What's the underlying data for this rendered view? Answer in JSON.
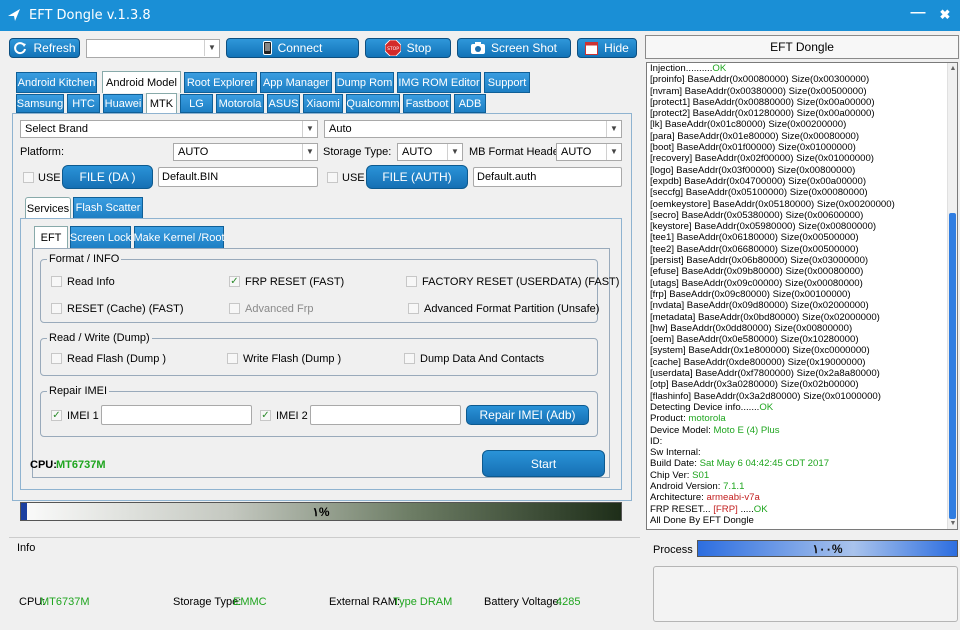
{
  "window": {
    "title": "EFT Dongle  v.1.3.8",
    "minimize": "—",
    "close": "✖"
  },
  "toolbar": {
    "refresh": "Refresh",
    "connect": "Connect",
    "stop": "Stop",
    "screenshot": "Screen Shot",
    "hide": "Hide",
    "stop_icon_text": "STOP",
    "port_value": ""
  },
  "main_tabs": [
    "Android Kitchen",
    "Android Model",
    "Root Explorer",
    "App Manager",
    "Dump Rom",
    "IMG ROM Editor",
    "Support"
  ],
  "brand_tabs": [
    "Samsung",
    "HTC",
    "Huawei",
    "MTK",
    "LG",
    "Motorola",
    "ASUS",
    "Xiaomi",
    "Qualcomm",
    "Fastboot",
    "ADB"
  ],
  "brand_select": {
    "value": "Select Brand"
  },
  "model_select": {
    "value": "Auto"
  },
  "platform": {
    "label": "Platform:",
    "value": "AUTO"
  },
  "storage": {
    "label": "Storage Type:",
    "value": "AUTO"
  },
  "mb_format": {
    "label": "MB Format Header",
    "value": "AUTO"
  },
  "da": {
    "use": "USE",
    "button": "FILE (DA )",
    "value": "Default.BIN"
  },
  "auth": {
    "use": "USE",
    "button": "FILE (AUTH)",
    "value": "Default.auth"
  },
  "sub_tabs": [
    "Services",
    "Flash Scatter"
  ],
  "service_tabs": [
    "EFT",
    "Screen Lock",
    "Make Kernel  /Root"
  ],
  "format_group": {
    "title": "Format / INFO",
    "items": [
      {
        "label": "Read Info",
        "checked": false
      },
      {
        "label": "FRP RESET (FAST)",
        "checked": true
      },
      {
        "label": "FACTORY RESET (USERDATA) (FAST)",
        "checked": false
      },
      {
        "label": "RESET (Cache) (FAST)",
        "checked": false
      },
      {
        "label": "Advanced Frp",
        "checked": false
      },
      {
        "label": "Advanced Format Partition (Unsafe)",
        "checked": false
      }
    ]
  },
  "rw_group": {
    "title": "Read / Write (Dump)",
    "items": [
      {
        "label": "Read Flash (Dump )",
        "checked": false
      },
      {
        "label": "Write Flash (Dump )",
        "checked": false
      },
      {
        "label": "Dump Data And Contacts",
        "checked": false
      }
    ]
  },
  "imei_group": {
    "title": "Repair IMEI",
    "imei1": {
      "label": "IMEI 1",
      "checked": true,
      "value": ""
    },
    "imei2": {
      "label": "IMEI 2",
      "checked": true,
      "value": ""
    },
    "repair_button": "Repair IMEI (Adb)"
  },
  "cpu": {
    "label": "CPU:",
    "value": "MT6737M"
  },
  "start_button": "Start",
  "progress_main": {
    "text": "١%",
    "value": 0.01
  },
  "info": {
    "title": "Info",
    "cpu_label": "CPU:",
    "cpu_value": "MT6737M",
    "storage_label": "Storage Type:",
    "storage_value": "EMMC",
    "ram_label": "External RAM:",
    "ram_value": "Type DRAM",
    "battery_label": "Battery Voltage:",
    "battery_value": "4285"
  },
  "log_panel": {
    "title": "EFT Dongle",
    "lines": [
      [
        [
          "Injection..........",
          ""
        ],
        [
          "OK",
          "green"
        ]
      ],
      [
        [
          "[proinfo] BaseAddr(0x00080000) Size(0x00300000)",
          ""
        ]
      ],
      [
        [
          "[nvram] BaseAddr(0x00380000) Size(0x00500000)",
          ""
        ]
      ],
      [
        [
          "[protect1] BaseAddr(0x00880000) Size(0x00a00000)",
          ""
        ]
      ],
      [
        [
          "[protect2] BaseAddr(0x01280000) Size(0x00a00000)",
          ""
        ]
      ],
      [
        [
          "[lk] BaseAddr(0x01c80000) Size(0x00200000)",
          ""
        ]
      ],
      [
        [
          "[para] BaseAddr(0x01e80000) Size(0x00080000)",
          ""
        ]
      ],
      [
        [
          "[boot] BaseAddr(0x01f00000) Size(0x01000000)",
          ""
        ]
      ],
      [
        [
          "[recovery] BaseAddr(0x02f00000) Size(0x01000000)",
          ""
        ]
      ],
      [
        [
          "[logo] BaseAddr(0x03f00000) Size(0x00800000)",
          ""
        ]
      ],
      [
        [
          "[expdb] BaseAddr(0x04700000) Size(0x00a00000)",
          ""
        ]
      ],
      [
        [
          "[seccfg] BaseAddr(0x05100000) Size(0x00080000)",
          ""
        ]
      ],
      [
        [
          "[oemkeystore] BaseAddr(0x05180000) Size(0x00200000)",
          ""
        ]
      ],
      [
        [
          "[secro] BaseAddr(0x05380000) Size(0x00600000)",
          ""
        ]
      ],
      [
        [
          "[keystore] BaseAddr(0x05980000) Size(0x00800000)",
          ""
        ]
      ],
      [
        [
          "[tee1] BaseAddr(0x06180000) Size(0x00500000)",
          ""
        ]
      ],
      [
        [
          "[tee2] BaseAddr(0x06680000) Size(0x00500000)",
          ""
        ]
      ],
      [
        [
          "[persist] BaseAddr(0x06b80000) Size(0x03000000)",
          ""
        ]
      ],
      [
        [
          "[efuse] BaseAddr(0x09b80000) Size(0x00080000)",
          ""
        ]
      ],
      [
        [
          "[utags] BaseAddr(0x09c00000) Size(0x00080000)",
          ""
        ]
      ],
      [
        [
          "[frp] BaseAddr(0x09c80000) Size(0x00100000)",
          ""
        ]
      ],
      [
        [
          "[nvdata] BaseAddr(0x09d80000) Size(0x02000000)",
          ""
        ]
      ],
      [
        [
          "[metadata] BaseAddr(0x0bd80000) Size(0x02000000)",
          ""
        ]
      ],
      [
        [
          "[hw] BaseAddr(0x0dd80000) Size(0x00800000)",
          ""
        ]
      ],
      [
        [
          "[oem] BaseAddr(0x0e580000) Size(0x10280000)",
          ""
        ]
      ],
      [
        [
          "[system] BaseAddr(0x1e800000) Size(0xc0000000)",
          ""
        ]
      ],
      [
        [
          "[cache] BaseAddr(0xde800000) Size(0x19000000)",
          ""
        ]
      ],
      [
        [
          "[userdata] BaseAddr(0xf7800000) Size(0x2a8a80000)",
          ""
        ]
      ],
      [
        [
          "[otp] BaseAddr(0x3a0280000) Size(0x02b00000)",
          ""
        ]
      ],
      [
        [
          "[flashinfo] BaseAddr(0x3a2d80000) Size(0x01000000)",
          ""
        ]
      ],
      [
        [
          "Detecting Device info.......",
          ""
        ],
        [
          "OK",
          "green"
        ]
      ],
      [
        [
          "Product: ",
          ""
        ],
        [
          "motorola",
          "green"
        ]
      ],
      [
        [
          "Device Model: ",
          ""
        ],
        [
          "Moto E (4) Plus",
          "green"
        ]
      ],
      [
        [
          "ID:",
          ""
        ]
      ],
      [
        [
          "Sw Internal:",
          ""
        ]
      ],
      [
        [
          "Build Date: ",
          ""
        ],
        [
          "Sat May 6 04:42:45 CDT 2017",
          "green"
        ]
      ],
      [
        [
          "Chip Ver: ",
          ""
        ],
        [
          "S01",
          "green"
        ]
      ],
      [
        [
          "Android Version: ",
          ""
        ],
        [
          "7.1.1",
          "green"
        ]
      ],
      [
        [
          "Architecture: ",
          ""
        ],
        [
          "armeabi-v7a",
          "red"
        ]
      ],
      [
        [
          "FRP RESET... ",
          ""
        ],
        [
          "[FRP]",
          "red"
        ],
        [
          " .....",
          ""
        ],
        [
          "OK",
          "green"
        ]
      ],
      [
        [
          "All Done By EFT Dongle",
          ""
        ]
      ]
    ]
  },
  "process": {
    "label": "Process",
    "text": "١٠٠%",
    "value": 1.0
  },
  "colors": {
    "accent": "#1a8fd6",
    "green": "#1fa51f",
    "red": "#c21e1e"
  }
}
